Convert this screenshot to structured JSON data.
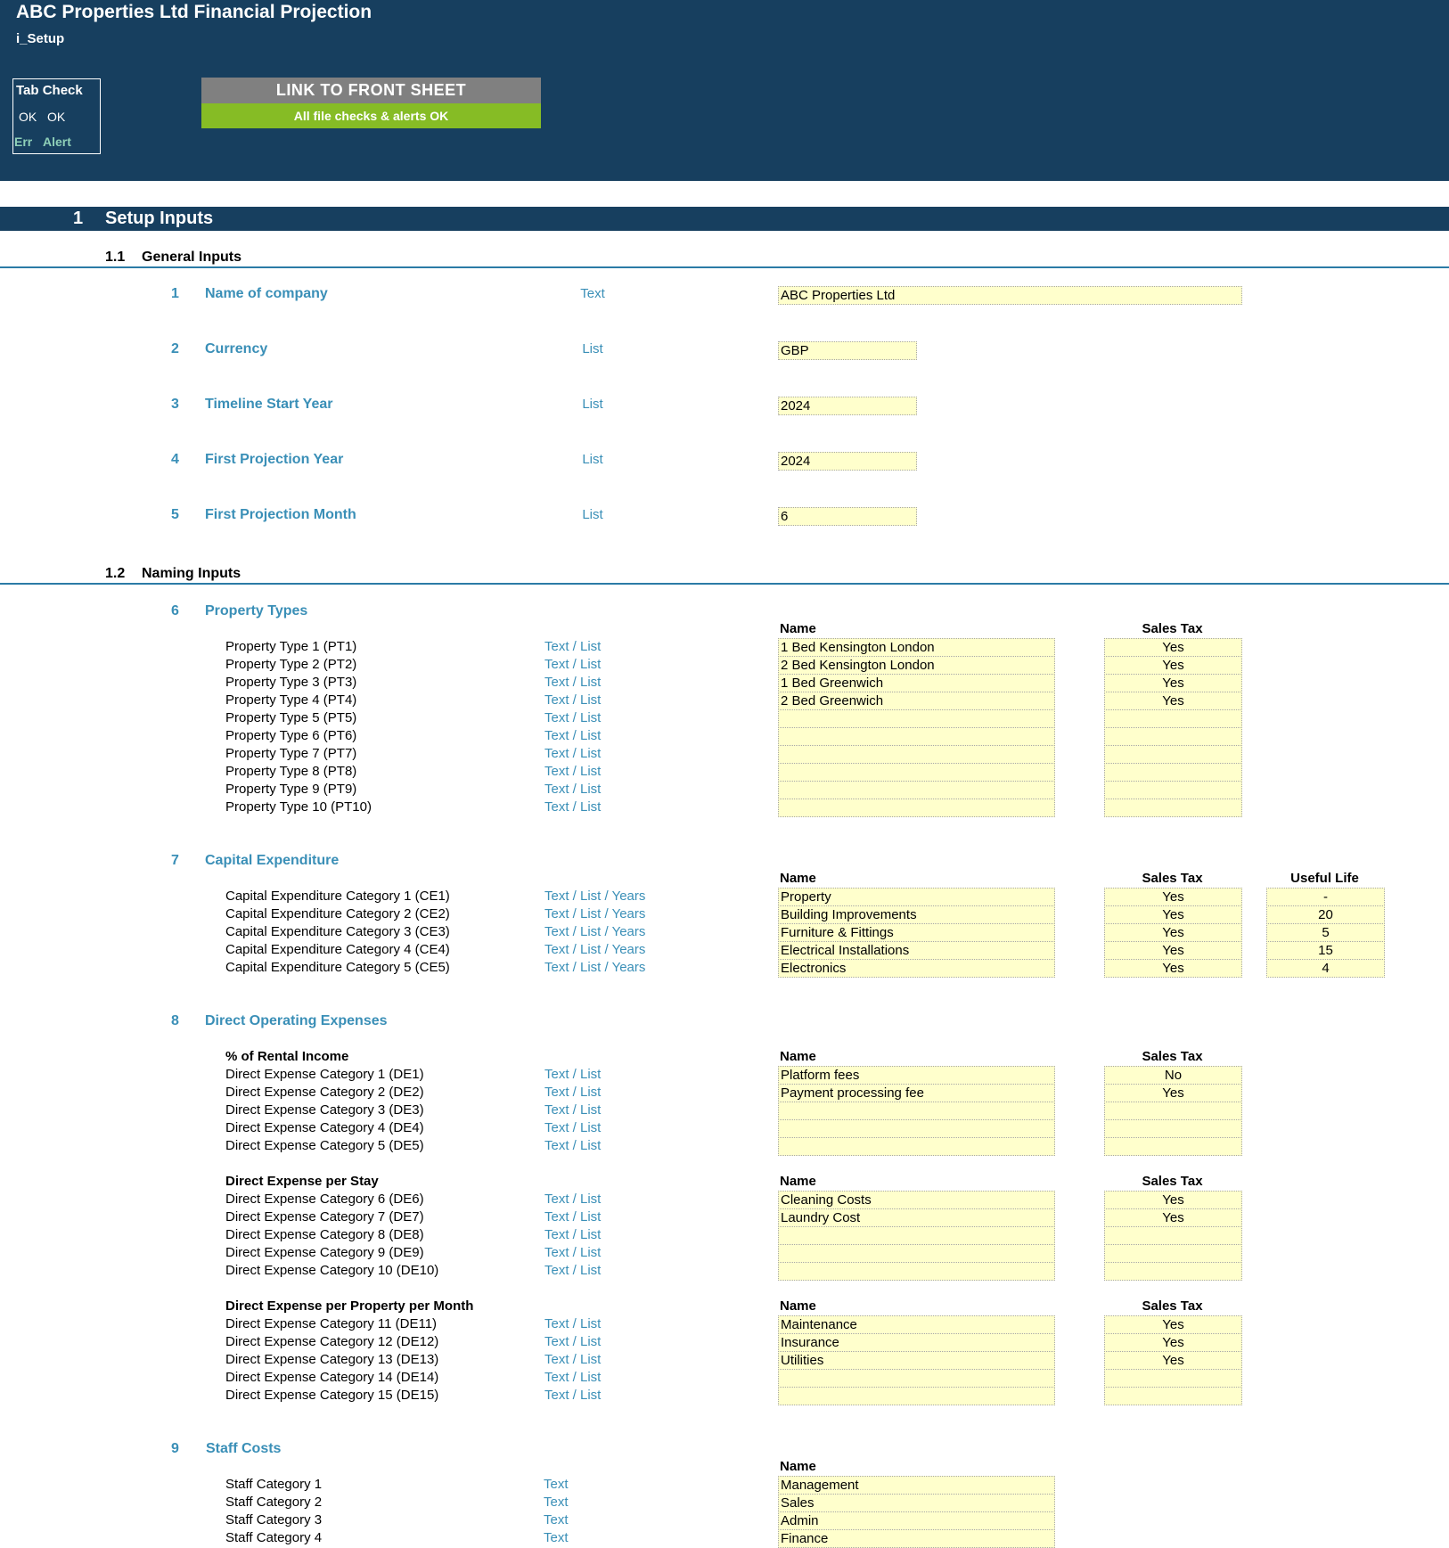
{
  "header": {
    "title": "ABC Properties Ltd Financial Projection",
    "sheet": "i_Setup",
    "tab_check": {
      "title": "Tab Check",
      "ok1": "OK",
      "ok2": "OK",
      "err": "Err",
      "alert": "Alert"
    },
    "link_button": "LINK TO FRONT SHEET",
    "status": "All file checks & alerts OK"
  },
  "section": {
    "number": "1",
    "title": "Setup Inputs"
  },
  "general": {
    "number": "1.1",
    "title": "General Inputs",
    "items": [
      {
        "num": "1",
        "title": "Name of company",
        "type": "Text",
        "value": "ABC Properties Ltd"
      },
      {
        "num": "2",
        "title": "Currency",
        "type": "List",
        "value": "GBP"
      },
      {
        "num": "3",
        "title": "Timeline Start Year",
        "type": "List",
        "value": "2024"
      },
      {
        "num": "4",
        "title": "First Projection Year",
        "type": "List",
        "value": "2024"
      },
      {
        "num": "5",
        "title": "First Projection Month",
        "type": "List",
        "value": "6"
      }
    ]
  },
  "naming": {
    "number": "1.2",
    "title": "Naming Inputs",
    "col_name": "Name",
    "col_tax": "Sales Tax",
    "col_life": "Useful Life",
    "property": {
      "num": "6",
      "title": "Property Types",
      "rows": [
        {
          "label": "Property Type 1 (PT1)",
          "type": "Text / List",
          "name": "1 Bed Kensington London",
          "tax": "Yes"
        },
        {
          "label": "Property Type 2 (PT2)",
          "type": "Text / List",
          "name": "2 Bed Kensington London",
          "tax": "Yes"
        },
        {
          "label": "Property Type 3 (PT3)",
          "type": "Text / List",
          "name": "1 Bed Greenwich",
          "tax": "Yes"
        },
        {
          "label": "Property Type 4 (PT4)",
          "type": "Text / List",
          "name": "2 Bed Greenwich",
          "tax": "Yes"
        },
        {
          "label": "Property Type 5 (PT5)",
          "type": "Text / List",
          "name": "",
          "tax": ""
        },
        {
          "label": "Property Type 6 (PT6)",
          "type": "Text / List",
          "name": "",
          "tax": ""
        },
        {
          "label": "Property Type 7 (PT7)",
          "type": "Text / List",
          "name": "",
          "tax": ""
        },
        {
          "label": "Property Type 8 (PT8)",
          "type": "Text / List",
          "name": "",
          "tax": ""
        },
        {
          "label": "Property Type 9 (PT9)",
          "type": "Text / List",
          "name": "",
          "tax": ""
        },
        {
          "label": "Property Type 10 (PT10)",
          "type": "Text / List",
          "name": "",
          "tax": ""
        }
      ]
    },
    "capex": {
      "num": "7",
      "title": "Capital Expenditure",
      "rows": [
        {
          "label": "Capital Expenditure Category 1 (CE1)",
          "type": "Text / List / Years",
          "name": "Property",
          "tax": "Yes",
          "life": "-"
        },
        {
          "label": "Capital Expenditure Category 2 (CE2)",
          "type": "Text / List / Years",
          "name": "Building Improvements",
          "tax": "Yes",
          "life": "20"
        },
        {
          "label": "Capital Expenditure Category 3 (CE3)",
          "type": "Text / List / Years",
          "name": "Furniture & Fittings",
          "tax": "Yes",
          "life": "5"
        },
        {
          "label": "Capital Expenditure Category 4 (CE4)",
          "type": "Text / List / Years",
          "name": "Electrical Installations",
          "tax": "Yes",
          "life": "15"
        },
        {
          "label": "Capital Expenditure Category 5 (CE5)",
          "type": "Text / List / Years",
          "name": "Electronics",
          "tax": "Yes",
          "life": "4"
        }
      ]
    },
    "direct": {
      "num": "8",
      "title": "Direct Operating Expenses",
      "groups": [
        {
          "title": "% of Rental Income",
          "rows": [
            {
              "label": "Direct Expense Category 1 (DE1)",
              "type": "Text / List",
              "name": "Platform fees",
              "tax": "No"
            },
            {
              "label": "Direct Expense Category 2 (DE2)",
              "type": "Text / List",
              "name": "Payment processing fee",
              "tax": "Yes"
            },
            {
              "label": "Direct Expense Category 3 (DE3)",
              "type": "Text / List",
              "name": "",
              "tax": ""
            },
            {
              "label": "Direct Expense Category 4 (DE4)",
              "type": "Text / List",
              "name": "",
              "tax": ""
            },
            {
              "label": "Direct Expense Category 5 (DE5)",
              "type": "Text / List",
              "name": "",
              "tax": ""
            }
          ]
        },
        {
          "title": "Direct Expense per Stay",
          "rows": [
            {
              "label": "Direct Expense Category 6 (DE6)",
              "type": "Text / List",
              "name": "Cleaning Costs",
              "tax": "Yes"
            },
            {
              "label": "Direct Expense Category 7 (DE7)",
              "type": "Text / List",
              "name": "Laundry Cost",
              "tax": "Yes"
            },
            {
              "label": "Direct Expense Category 8 (DE8)",
              "type": "Text / List",
              "name": "",
              "tax": ""
            },
            {
              "label": "Direct Expense Category 9 (DE9)",
              "type": "Text / List",
              "name": "",
              "tax": ""
            },
            {
              "label": "Direct Expense Category 10 (DE10)",
              "type": "Text / List",
              "name": "",
              "tax": ""
            }
          ]
        },
        {
          "title": "Direct Expense per Property per Month",
          "rows": [
            {
              "label": "Direct Expense Category 11 (DE11)",
              "type": "Text / List",
              "name": "Maintenance",
              "tax": "Yes"
            },
            {
              "label": "Direct Expense Category 12 (DE12)",
              "type": "Text / List",
              "name": "Insurance",
              "tax": "Yes"
            },
            {
              "label": "Direct Expense Category 13 (DE13)",
              "type": "Text / List",
              "name": "Utilities",
              "tax": "Yes"
            },
            {
              "label": "Direct Expense Category 14 (DE14)",
              "type": "Text / List",
              "name": "",
              "tax": ""
            },
            {
              "label": "Direct Expense Category 15 (DE15)",
              "type": "Text / List",
              "name": "",
              "tax": ""
            }
          ]
        }
      ]
    },
    "staff": {
      "num": "9",
      "title": "Staff Costs",
      "rows": [
        {
          "label": "Staff Category 1",
          "type": "Text",
          "name": "Management"
        },
        {
          "label": "Staff Category 2",
          "type": "Text",
          "name": "Sales"
        },
        {
          "label": "Staff Category 3",
          "type": "Text",
          "name": "Admin"
        },
        {
          "label": "Staff Category 4",
          "type": "Text",
          "name": "Finance"
        }
      ]
    }
  }
}
